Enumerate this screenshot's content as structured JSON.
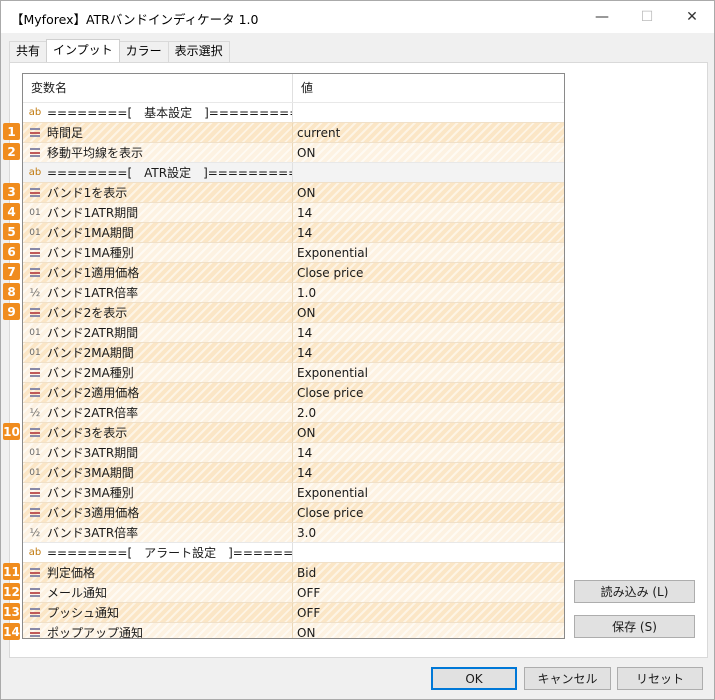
{
  "window": {
    "title": "【Myforex】ATRバンドインディケータ 1.0",
    "minimize_glyph": "—",
    "maximize_glyph": "☐",
    "close_glyph": "✕"
  },
  "tabs": [
    {
      "label": "共有",
      "active": false
    },
    {
      "label": "インプット",
      "active": true
    },
    {
      "label": "カラー",
      "active": false
    },
    {
      "label": "表示選択",
      "active": false
    }
  ],
  "grid": {
    "header": {
      "name": "変数名",
      "value": "値"
    },
    "rows": [
      {
        "kind": "section",
        "icon": "ab",
        "name": "========[　基本設定　]=========",
        "value": ""
      },
      {
        "kind": "param",
        "icon": "list",
        "name": "時間足",
        "value": "current",
        "badge": "1"
      },
      {
        "kind": "param",
        "icon": "list",
        "name": "移動平均線を表示",
        "value": "ON",
        "badge": "2"
      },
      {
        "kind": "section",
        "icon": "ab",
        "name": "========[　ATR設定　]=========",
        "value": ""
      },
      {
        "kind": "param",
        "icon": "list",
        "name": "バンド1を表示",
        "value": "ON",
        "badge": "3"
      },
      {
        "kind": "param",
        "icon": "01",
        "name": "バンド1ATR期間",
        "value": "14",
        "badge": "4"
      },
      {
        "kind": "param",
        "icon": "01",
        "name": "バンド1MA期間",
        "value": "14",
        "badge": "5"
      },
      {
        "kind": "param",
        "icon": "list",
        "name": "バンド1MA種別",
        "value": "Exponential",
        "badge": "6"
      },
      {
        "kind": "param",
        "icon": "list",
        "name": "バンド1適用価格",
        "value": "Close price",
        "badge": "7"
      },
      {
        "kind": "param",
        "icon": "½",
        "name": "バンド1ATR倍率",
        "value": "1.0",
        "badge": "8"
      },
      {
        "kind": "param",
        "icon": "list",
        "name": "バンド2を表示",
        "value": "ON",
        "badge": "9"
      },
      {
        "kind": "param",
        "icon": "01",
        "name": "バンド2ATR期間",
        "value": "14",
        "badge": ""
      },
      {
        "kind": "param",
        "icon": "01",
        "name": "バンド2MA期間",
        "value": "14",
        "badge": ""
      },
      {
        "kind": "param",
        "icon": "list",
        "name": "バンド2MA種別",
        "value": "Exponential",
        "badge": ""
      },
      {
        "kind": "param",
        "icon": "list",
        "name": "バンド2適用価格",
        "value": "Close price",
        "badge": ""
      },
      {
        "kind": "param",
        "icon": "½",
        "name": "バンド2ATR倍率",
        "value": "2.0",
        "badge": ""
      },
      {
        "kind": "param",
        "icon": "list",
        "name": "バンド3を表示",
        "value": "ON",
        "badge": "10"
      },
      {
        "kind": "param",
        "icon": "01",
        "name": "バンド3ATR期間",
        "value": "14",
        "badge": ""
      },
      {
        "kind": "param",
        "icon": "01",
        "name": "バンド3MA期間",
        "value": "14",
        "badge": ""
      },
      {
        "kind": "param",
        "icon": "list",
        "name": "バンド3MA種別",
        "value": "Exponential",
        "badge": ""
      },
      {
        "kind": "param",
        "icon": "list",
        "name": "バンド3適用価格",
        "value": "Close price",
        "badge": ""
      },
      {
        "kind": "param",
        "icon": "½",
        "name": "バンド3ATR倍率",
        "value": "3.0",
        "badge": ""
      },
      {
        "kind": "section",
        "icon": "ab",
        "name": "========[　アラート設定　]=========",
        "value": ""
      },
      {
        "kind": "param",
        "icon": "list",
        "name": "判定価格",
        "value": "Bid",
        "badge": "11"
      },
      {
        "kind": "param",
        "icon": "list",
        "name": "メール通知",
        "value": "OFF",
        "badge": "12"
      },
      {
        "kind": "param",
        "icon": "list",
        "name": "プッシュ通知",
        "value": "OFF",
        "badge": "13"
      },
      {
        "kind": "param",
        "icon": "list",
        "name": "ポップアップ通知",
        "value": "ON",
        "badge": "14"
      }
    ]
  },
  "side_buttons": {
    "load": "読み込み (L)",
    "save": "保存 (S)"
  },
  "footer": {
    "ok": "OK",
    "cancel": "キャンセル",
    "reset": "リセット"
  },
  "colors": {
    "badge": "#f08c1e",
    "row_hatch": "#fbe6c6",
    "ok_border": "#0078d7"
  }
}
